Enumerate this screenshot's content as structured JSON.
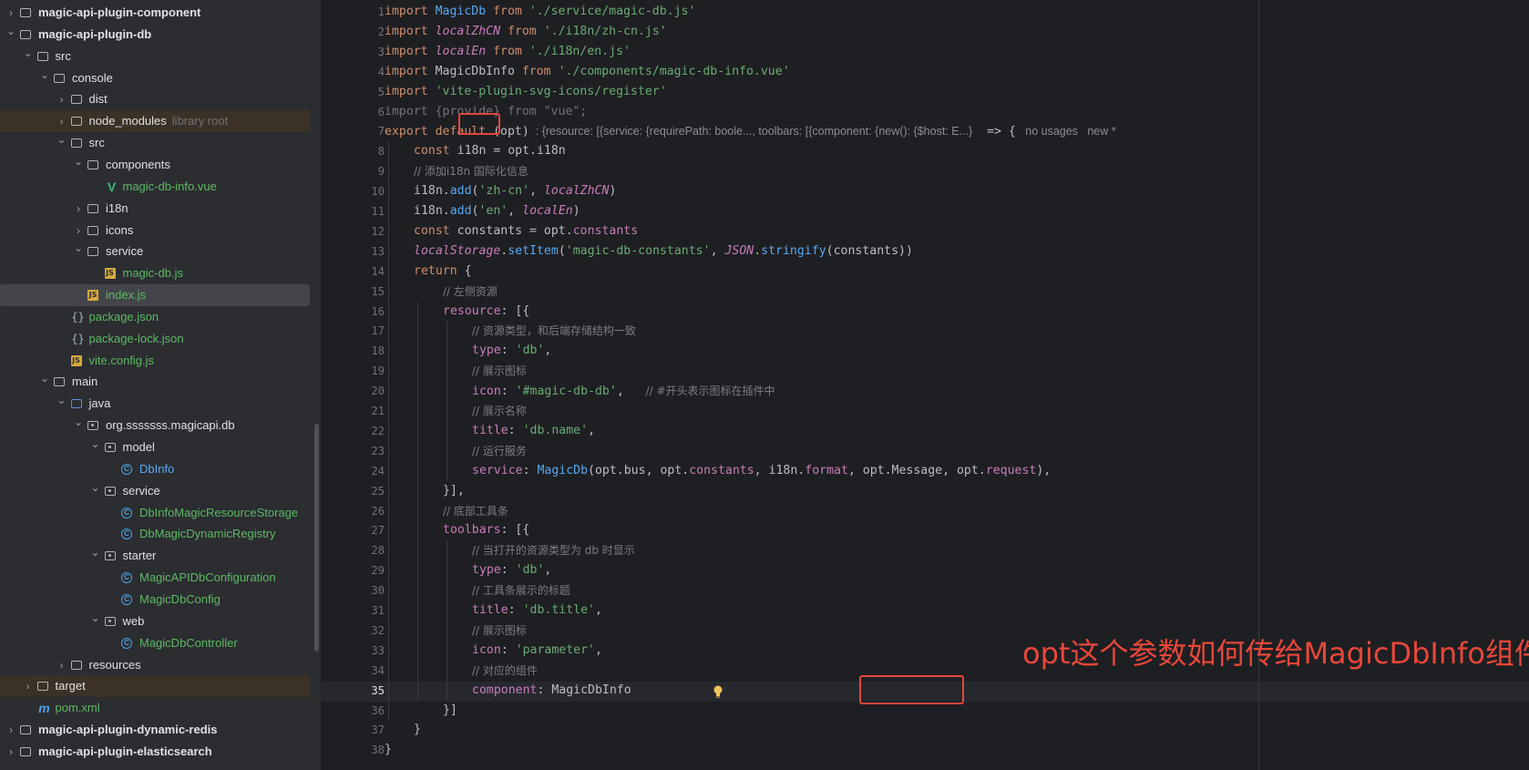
{
  "tree": [
    {
      "label": "magic-api-plugin-component",
      "depth": 0,
      "arrow": "right",
      "icon": "folder",
      "bold": true
    },
    {
      "label": "magic-api-plugin-db",
      "depth": 0,
      "arrow": "down",
      "icon": "folder",
      "bold": true
    },
    {
      "label": "src",
      "depth": 1,
      "arrow": "down",
      "icon": "folder"
    },
    {
      "label": "console",
      "depth": 2,
      "arrow": "down",
      "icon": "folder"
    },
    {
      "label": "dist",
      "depth": 3,
      "arrow": "right",
      "icon": "folder"
    },
    {
      "label": "node_modules",
      "depth": 3,
      "arrow": "right",
      "icon": "folder",
      "hint": "library root",
      "lib": true
    },
    {
      "label": "src",
      "depth": 3,
      "arrow": "down",
      "icon": "folder"
    },
    {
      "label": "components",
      "depth": 4,
      "arrow": "down",
      "icon": "folder"
    },
    {
      "label": "magic-db-info.vue",
      "depth": 5,
      "arrow": "",
      "icon": "vue",
      "color": "green"
    },
    {
      "label": "i18n",
      "depth": 4,
      "arrow": "right",
      "icon": "folder"
    },
    {
      "label": "icons",
      "depth": 4,
      "arrow": "right",
      "icon": "folder"
    },
    {
      "label": "service",
      "depth": 4,
      "arrow": "down",
      "icon": "folder"
    },
    {
      "label": "magic-db.js",
      "depth": 5,
      "arrow": "",
      "icon": "js",
      "color": "green"
    },
    {
      "label": "index.js",
      "depth": 4,
      "arrow": "",
      "icon": "js",
      "color": "green",
      "selected": true
    },
    {
      "label": "package.json",
      "depth": 3,
      "arrow": "",
      "icon": "json",
      "color": "green"
    },
    {
      "label": "package-lock.json",
      "depth": 3,
      "arrow": "",
      "icon": "json",
      "color": "green"
    },
    {
      "label": "vite.config.js",
      "depth": 3,
      "arrow": "",
      "icon": "js",
      "color": "green"
    },
    {
      "label": "main",
      "depth": 2,
      "arrow": "down",
      "icon": "folder"
    },
    {
      "label": "java",
      "depth": 3,
      "arrow": "down",
      "icon": "src"
    },
    {
      "label": "org.sssssss.magicapi.db",
      "depth": 4,
      "arrow": "down",
      "icon": "pkg"
    },
    {
      "label": "model",
      "depth": 5,
      "arrow": "down",
      "icon": "pkg"
    },
    {
      "label": "DbInfo",
      "depth": 6,
      "arrow": "",
      "icon": "class",
      "color": "blue"
    },
    {
      "label": "service",
      "depth": 5,
      "arrow": "down",
      "icon": "pkg"
    },
    {
      "label": "DbInfoMagicResourceStorage",
      "depth": 6,
      "arrow": "",
      "icon": "class",
      "color": "green"
    },
    {
      "label": "DbMagicDynamicRegistry",
      "depth": 6,
      "arrow": "",
      "icon": "class",
      "color": "green"
    },
    {
      "label": "starter",
      "depth": 5,
      "arrow": "down",
      "icon": "pkg"
    },
    {
      "label": "MagicAPIDbConfiguration",
      "depth": 6,
      "arrow": "",
      "icon": "class",
      "color": "green"
    },
    {
      "label": "MagicDbConfig",
      "depth": 6,
      "arrow": "",
      "icon": "class",
      "color": "green"
    },
    {
      "label": "web",
      "depth": 5,
      "arrow": "down",
      "icon": "pkg"
    },
    {
      "label": "MagicDbController",
      "depth": 6,
      "arrow": "",
      "icon": "class",
      "color": "green"
    },
    {
      "label": "resources",
      "depth": 3,
      "arrow": "right",
      "icon": "folder"
    },
    {
      "label": "target",
      "depth": 1,
      "arrow": "right",
      "icon": "folder",
      "lib": true
    },
    {
      "label": "pom.xml",
      "depth": 1,
      "arrow": "",
      "icon": "maven",
      "color": "green"
    },
    {
      "label": "magic-api-plugin-dynamic-redis",
      "depth": 0,
      "arrow": "right",
      "icon": "folder",
      "bold": true
    },
    {
      "label": "magic-api-plugin-elasticsearch",
      "depth": 0,
      "arrow": "right",
      "icon": "folder",
      "bold": true
    }
  ],
  "code": [
    {
      "n": "1",
      "indent": 0,
      "t": [
        [
          "k",
          "import "
        ],
        [
          "fn",
          "MagicDb"
        ],
        [
          "k",
          " from "
        ],
        [
          "s",
          "'./service/magic-db.js'"
        ]
      ]
    },
    {
      "n": "2",
      "indent": 0,
      "t": [
        [
          "k",
          "import "
        ],
        [
          "it",
          "localZhCN"
        ],
        [
          "k",
          " from "
        ],
        [
          "s",
          "'./i18n/zh-cn.js'"
        ]
      ]
    },
    {
      "n": "3",
      "indent": 0,
      "t": [
        [
          "k",
          "import "
        ],
        [
          "it",
          "localEn"
        ],
        [
          "k",
          " from "
        ],
        [
          "s",
          "'./i18n/en.js'"
        ]
      ]
    },
    {
      "n": "4",
      "indent": 0,
      "t": [
        [
          "k",
          "import "
        ],
        [
          "p",
          "MagicDbInfo"
        ],
        [
          "k",
          " from "
        ],
        [
          "s",
          "'./components/magic-db-info.vue'"
        ]
      ]
    },
    {
      "n": "5",
      "indent": 0,
      "t": [
        [
          "k",
          "import "
        ],
        [
          "s",
          "'vite-plugin-svg-icons/register'"
        ]
      ]
    },
    {
      "n": "6",
      "indent": 0,
      "t": [
        [
          "dim",
          "import {provide} from \"vue\";"
        ]
      ]
    },
    {
      "n": "7",
      "indent": 0,
      "t": [
        [
          "k",
          "export default "
        ],
        [
          "p",
          "(opt)"
        ],
        [
          "hint-txt",
          "  : {resource: [{service: {requirePath: boole..., toolbars: [{component: {new(): {$host: E...}"
        ],
        [
          "p",
          "  => {"
        ],
        [
          "hint-txt",
          "   no usages   new *"
        ]
      ]
    },
    {
      "n": "8",
      "indent": 1,
      "t": [
        [
          "k",
          "const "
        ],
        [
          "p",
          "i18n = opt.i18n"
        ]
      ]
    },
    {
      "n": "9",
      "indent": 1,
      "t": [
        [
          "cm",
          "// 添加i18n 国际化信息"
        ]
      ]
    },
    {
      "n": "10",
      "indent": 1,
      "t": [
        [
          "p",
          "i18n."
        ],
        [
          "fn",
          "add"
        ],
        [
          "p",
          "("
        ],
        [
          "s",
          "'zh-cn'"
        ],
        [
          "p",
          ", "
        ],
        [
          "it",
          "localZhCN"
        ],
        [
          "p",
          ")"
        ]
      ]
    },
    {
      "n": "11",
      "indent": 1,
      "t": [
        [
          "p",
          "i18n."
        ],
        [
          "fn",
          "add"
        ],
        [
          "p",
          "("
        ],
        [
          "s",
          "'en'"
        ],
        [
          "p",
          ", "
        ],
        [
          "it",
          "localEn"
        ],
        [
          "p",
          ")"
        ]
      ]
    },
    {
      "n": "12",
      "indent": 1,
      "t": [
        [
          "k",
          "const "
        ],
        [
          "p",
          "constants = opt."
        ],
        [
          "pp",
          "constants"
        ]
      ]
    },
    {
      "n": "13",
      "indent": 1,
      "t": [
        [
          "it",
          "localStorage"
        ],
        [
          "p",
          "."
        ],
        [
          "fn",
          "setItem"
        ],
        [
          "p",
          "("
        ],
        [
          "s",
          "'magic-db-constants'"
        ],
        [
          "p",
          ", "
        ],
        [
          "it",
          "JSON"
        ],
        [
          "p",
          "."
        ],
        [
          "fn",
          "stringify"
        ],
        [
          "p",
          "(constants))"
        ]
      ]
    },
    {
      "n": "14",
      "indent": 1,
      "t": [
        [
          "k",
          "return "
        ],
        [
          "p",
          "{"
        ]
      ]
    },
    {
      "n": "15",
      "indent": 2,
      "t": [
        [
          "cm",
          "// 左侧资源"
        ]
      ]
    },
    {
      "n": "16",
      "indent": 2,
      "t": [
        [
          "pp",
          "resource"
        ],
        [
          "p",
          ": [{"
        ]
      ]
    },
    {
      "n": "17",
      "indent": 3,
      "t": [
        [
          "cm",
          "// 资源类型，和后端存储结构一致"
        ]
      ]
    },
    {
      "n": "18",
      "indent": 3,
      "t": [
        [
          "pp",
          "type"
        ],
        [
          "p",
          ": "
        ],
        [
          "s",
          "'db'"
        ],
        [
          "p",
          ","
        ]
      ]
    },
    {
      "n": "19",
      "indent": 3,
      "t": [
        [
          "cm",
          "// 展示图标"
        ]
      ]
    },
    {
      "n": "20",
      "indent": 3,
      "t": [
        [
          "pp",
          "icon"
        ],
        [
          "p",
          ": "
        ],
        [
          "s",
          "'#magic-db-db'"
        ],
        [
          "p",
          ",   "
        ],
        [
          "cm",
          "// #开头表示图标在插件中"
        ]
      ]
    },
    {
      "n": "21",
      "indent": 3,
      "t": [
        [
          "cm",
          "// 展示名称"
        ]
      ]
    },
    {
      "n": "22",
      "indent": 3,
      "t": [
        [
          "pp",
          "title"
        ],
        [
          "p",
          ": "
        ],
        [
          "s",
          "'db.name'"
        ],
        [
          "p",
          ","
        ]
      ]
    },
    {
      "n": "23",
      "indent": 3,
      "t": [
        [
          "cm",
          "// 运行服务"
        ]
      ]
    },
    {
      "n": "24",
      "indent": 3,
      "t": [
        [
          "pp",
          "service"
        ],
        [
          "p",
          ": "
        ],
        [
          "fn",
          "MagicDb"
        ],
        [
          "p",
          "(opt.bus, opt."
        ],
        [
          "pp",
          "constants"
        ],
        [
          "p",
          ", i18n."
        ],
        [
          "pp",
          "format"
        ],
        [
          "p",
          ", opt.Message, opt."
        ],
        [
          "pp",
          "request"
        ],
        [
          "p",
          "),"
        ]
      ]
    },
    {
      "n": "25",
      "indent": 2,
      "t": [
        [
          "p",
          "}],"
        ]
      ]
    },
    {
      "n": "26",
      "indent": 2,
      "t": [
        [
          "cm",
          "// 底部工具条"
        ]
      ]
    },
    {
      "n": "27",
      "indent": 2,
      "t": [
        [
          "pp",
          "toolbars"
        ],
        [
          "p",
          ": [{"
        ]
      ]
    },
    {
      "n": "28",
      "indent": 3,
      "t": [
        [
          "cm",
          "// 当打开的资源类型为 db 时显示"
        ]
      ]
    },
    {
      "n": "29",
      "indent": 3,
      "t": [
        [
          "pp",
          "type"
        ],
        [
          "p",
          ": "
        ],
        [
          "s",
          "'db'"
        ],
        [
          "p",
          ","
        ]
      ]
    },
    {
      "n": "30",
      "indent": 3,
      "t": [
        [
          "cm",
          "// 工具条展示的标题"
        ]
      ]
    },
    {
      "n": "31",
      "indent": 3,
      "t": [
        [
          "pp",
          "title"
        ],
        [
          "p",
          ": "
        ],
        [
          "s",
          "'db.title'"
        ],
        [
          "p",
          ","
        ]
      ]
    },
    {
      "n": "32",
      "indent": 3,
      "t": [
        [
          "cm",
          "// 展示图标"
        ]
      ]
    },
    {
      "n": "33",
      "indent": 3,
      "t": [
        [
          "pp",
          "icon"
        ],
        [
          "p",
          ": "
        ],
        [
          "s",
          "'parameter'"
        ],
        [
          "p",
          ","
        ]
      ]
    },
    {
      "n": "34",
      "indent": 3,
      "t": [
        [
          "cm",
          "// 对应的组件"
        ]
      ]
    },
    {
      "n": "35",
      "indent": 3,
      "t": [
        [
          "pp",
          "component"
        ],
        [
          "p",
          ": MagicDbInfo"
        ]
      ]
    },
    {
      "n": "36",
      "indent": 2,
      "t": [
        [
          "p",
          "}]"
        ]
      ]
    },
    {
      "n": "37",
      "indent": 1,
      "t": [
        [
          "p",
          "}"
        ]
      ]
    },
    {
      "n": "38",
      "indent": 0,
      "t": [
        [
          "p",
          "}"
        ]
      ]
    }
  ],
  "current_line": "35",
  "annotation": {
    "question": "opt这个参数如何传给MagicDbInfo组件?"
  },
  "colors": {
    "accent_red": "#e0483c",
    "keyword": "#cf8e6d",
    "string": "#6aab73",
    "function": "#56a8f5",
    "property": "#c77dbb"
  }
}
